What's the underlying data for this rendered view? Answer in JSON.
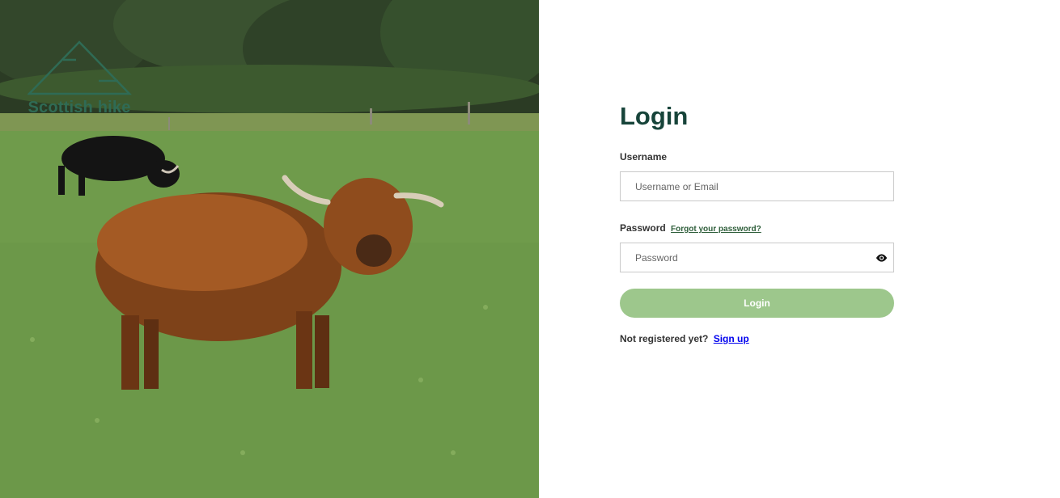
{
  "brand": {
    "name": "Scottish hike",
    "logo_icon": "mountain-icon",
    "accent": "#2f6b55"
  },
  "hero": {
    "image": "highland-cow-in-field"
  },
  "form": {
    "title": "Login",
    "username_label": "Username",
    "username_placeholder": "Username or Email",
    "password_label": "Password",
    "forgot_link": "Forgot your password?",
    "password_placeholder": "Password",
    "toggle_icon": "eye-icon",
    "submit_label": "Login",
    "not_registered": "Not registered yet?",
    "signup_link": "Sign up"
  },
  "colors": {
    "title": "#17443a",
    "button": "#9dc78c",
    "link": "#0000ee"
  }
}
